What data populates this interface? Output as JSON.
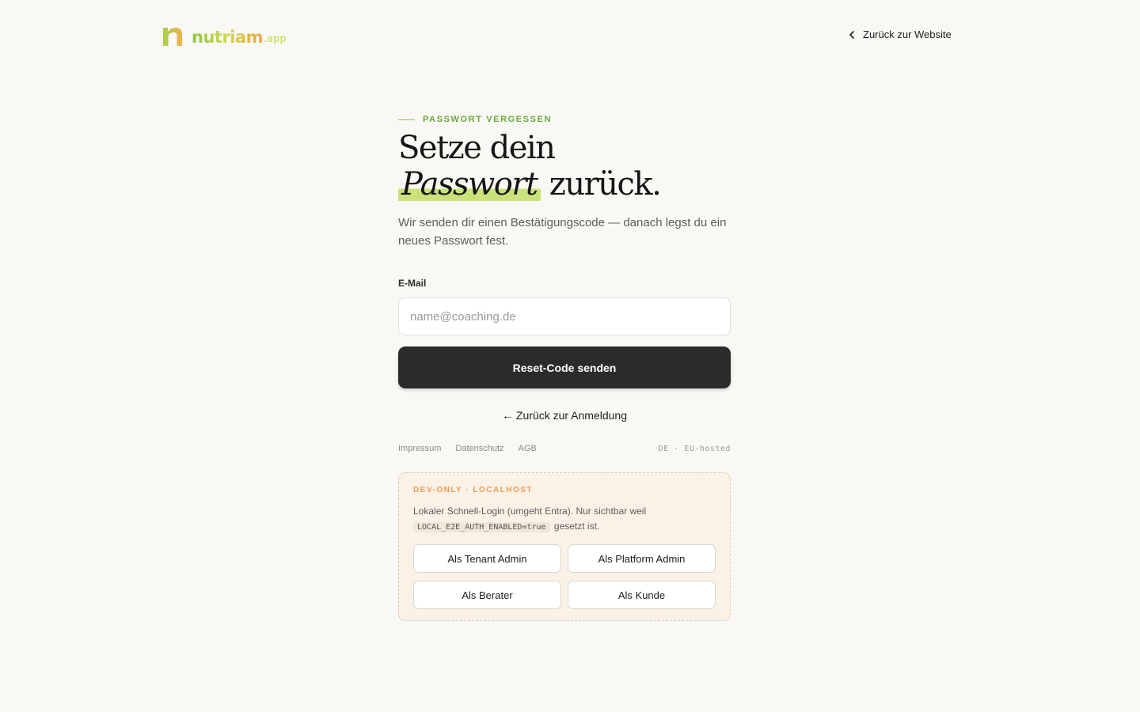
{
  "header": {
    "logo_word": "nutriam",
    "logo_tld": ".app",
    "back_website_label": "Zurück zur Website"
  },
  "hero": {
    "eyebrow": "PASSWORT VERGESSEN",
    "headline_line1": "Setze dein",
    "headline_highlight": "Passwort",
    "headline_line2_rest": "zurück.",
    "lede": "Wir senden dir einen Bestätigungscode — danach legst du ein neues Passwort fest."
  },
  "form": {
    "email_label": "E-Mail",
    "email_value": "",
    "email_placeholder": "name@coaching.de",
    "submit_label": "Reset-Code senden",
    "back_login_label": "← Zurück zur Anmeldung"
  },
  "footer": {
    "links": [
      "Impressum",
      "Datenschutz",
      "AGB"
    ],
    "locale": "DE · EU-hosted"
  },
  "dev": {
    "title": "DEV-ONLY · LOCALHOST",
    "text_before": "Lokaler Schnell-Login (umgeht Entra). Nur sichtbar weil",
    "code": "LOCAL_E2E_AUTH_ENABLED=true",
    "text_after": "gesetzt ist.",
    "buttons": [
      "Als Tenant Admin",
      "Als Platform Admin",
      "Als Berater",
      "Als Kunde"
    ]
  },
  "colors": {
    "background": "#f9f8f4",
    "brand_green": "#8cc63f",
    "brand_orange": "#f0a64b",
    "primary_button": "#2b2b2b",
    "dev_accent": "#ee9a52"
  }
}
